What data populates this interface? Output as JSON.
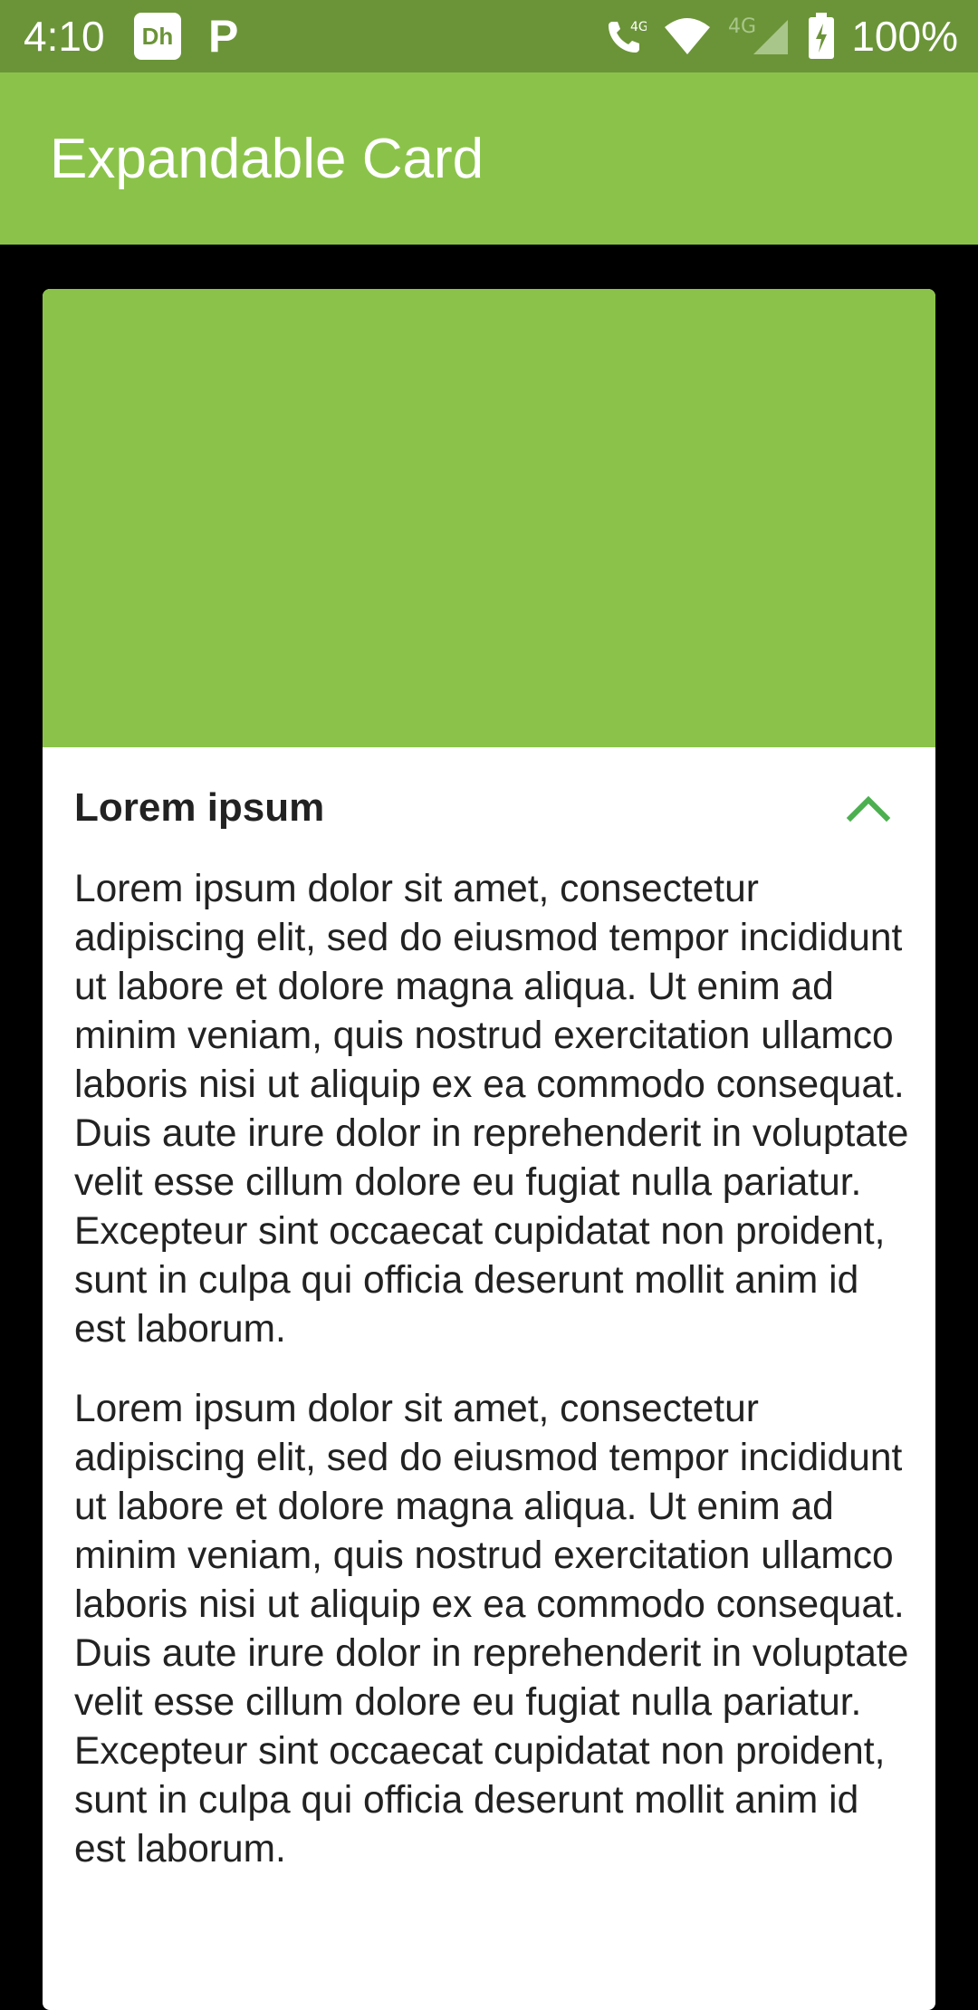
{
  "status_bar": {
    "time": "4:10",
    "app_icon_text": "Dh",
    "p_icon_text": "P",
    "network_label_1": "4G",
    "network_label_2": "4G",
    "battery_percent": "100%"
  },
  "app_bar": {
    "title": "Expandable Card"
  },
  "card": {
    "hero_color": "#8bc34a",
    "title": "Lorem ipsum",
    "toggle_icon": "chevron-up-icon",
    "paragraphs": [
      "Lorem ipsum dolor sit amet, consectetur adipiscing elit, sed do eiusmod tempor incididunt ut labore et dolore magna aliqua. Ut enim ad minim veniam, quis nostrud exercitation ullamco laboris nisi ut aliquip ex ea commodo consequat. Duis aute irure dolor in reprehenderit in voluptate velit esse cillum dolore eu fugiat nulla pariatur. Excepteur sint occaecat cupidatat non proident, sunt in culpa qui officia deserunt mollit anim id est laborum.",
      "Lorem ipsum dolor sit amet, consectetur adipiscing elit, sed do eiusmod tempor incididunt ut labore et dolore magna aliqua. Ut enim ad minim veniam, quis nostrud exercitation ullamco laboris nisi ut aliquip ex ea commodo consequat. Duis aute irure dolor in reprehenderit in voluptate velit esse cillum dolore eu fugiat nulla pariatur. Excepteur sint occaecat cupidatat non proident, sunt in culpa qui officia deserunt mollit anim id est laborum."
    ]
  },
  "colors": {
    "status_bar": "#6b9438",
    "app_bar": "#8bc34a",
    "accent": "#4caf50",
    "background": "#000000"
  }
}
